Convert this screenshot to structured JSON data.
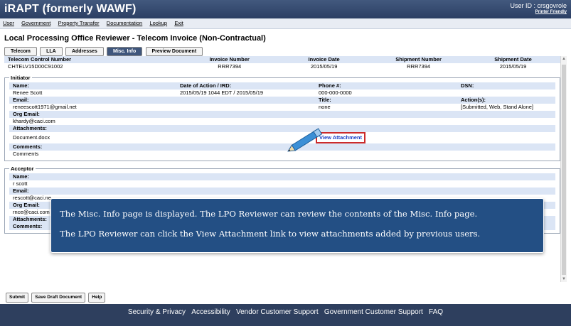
{
  "app": {
    "title": "iRAPT (formerly WAWF)",
    "user_label": "User ID : crsgovrole",
    "printer_friendly": "Printer Friendly"
  },
  "menu": [
    "User",
    "Government",
    "Property Transfer",
    "Documentation",
    "Lookup",
    "Exit"
  ],
  "page_title": "Local Processing Office Reviewer - Telecom Invoice (Non-Contractual)",
  "tabs": [
    "Telecom",
    "LLA",
    "Addresses",
    "Misc. Info",
    "Preview Document"
  ],
  "invoice": {
    "headers": [
      "Telecom Control Number",
      "Invoice Number",
      "Invoice Date",
      "Shipment Number",
      "Shipment Date"
    ],
    "values": [
      "CHTELV15D00C91002",
      "RRR7394",
      "2015/05/19",
      "RRR7394",
      "2015/05/19"
    ]
  },
  "initiator": {
    "legend": "Initiator",
    "name_label": "Name:",
    "name": "Renee Scott",
    "date_label": "Date of Action / IRD:",
    "date": "2015/05/19 1044 EDT / 2015/05/19",
    "phone_label": "Phone #:",
    "phone": "000-000-0000",
    "dsn_label": "DSN:",
    "dsn": "",
    "email_label": "Email:",
    "email": "reneescott1971@gmail.net",
    "title_label": "Title:",
    "title": "none",
    "actions_label": "Action(s):",
    "actions": "[Submitted, Web, Stand Alone]",
    "org_email_label": "Org Email:",
    "org_email": "khardy@caci.com",
    "attachments_label": "Attachments:",
    "attachment": "Document.docx",
    "view_attachment": "View Attachment",
    "comments_label": "Comments:",
    "comments": "Comments"
  },
  "acceptor": {
    "legend": "Acceptor",
    "name_label": "Name:",
    "name": "r scott",
    "email_label": "Email:",
    "email": "rescott@caci.ne",
    "org_email_label": "Org Email:",
    "org_email": "rnce@caci.com",
    "attachments_label": "Attachments:",
    "comments_label": "Comments:"
  },
  "overlay": {
    "line1": "The Misc. Info page is displayed.  The LPO Reviewer can review the contents of the Misc. Info page.",
    "line2": "The LPO Reviewer can click the View Attachment link to view attachments added by previous users."
  },
  "buttons": [
    "Submit",
    "Save Draft Document",
    "Help"
  ],
  "footer": [
    "Security & Privacy",
    "Accessibility",
    "Vendor Customer Support",
    "Government Customer Support",
    "FAQ"
  ],
  "colors": {
    "header_bar": "#2b3f63",
    "section_bg": "#dbe5f5",
    "overlay": "#234f84",
    "highlight": "#cc2b2b",
    "link": "#1a3fc7"
  }
}
